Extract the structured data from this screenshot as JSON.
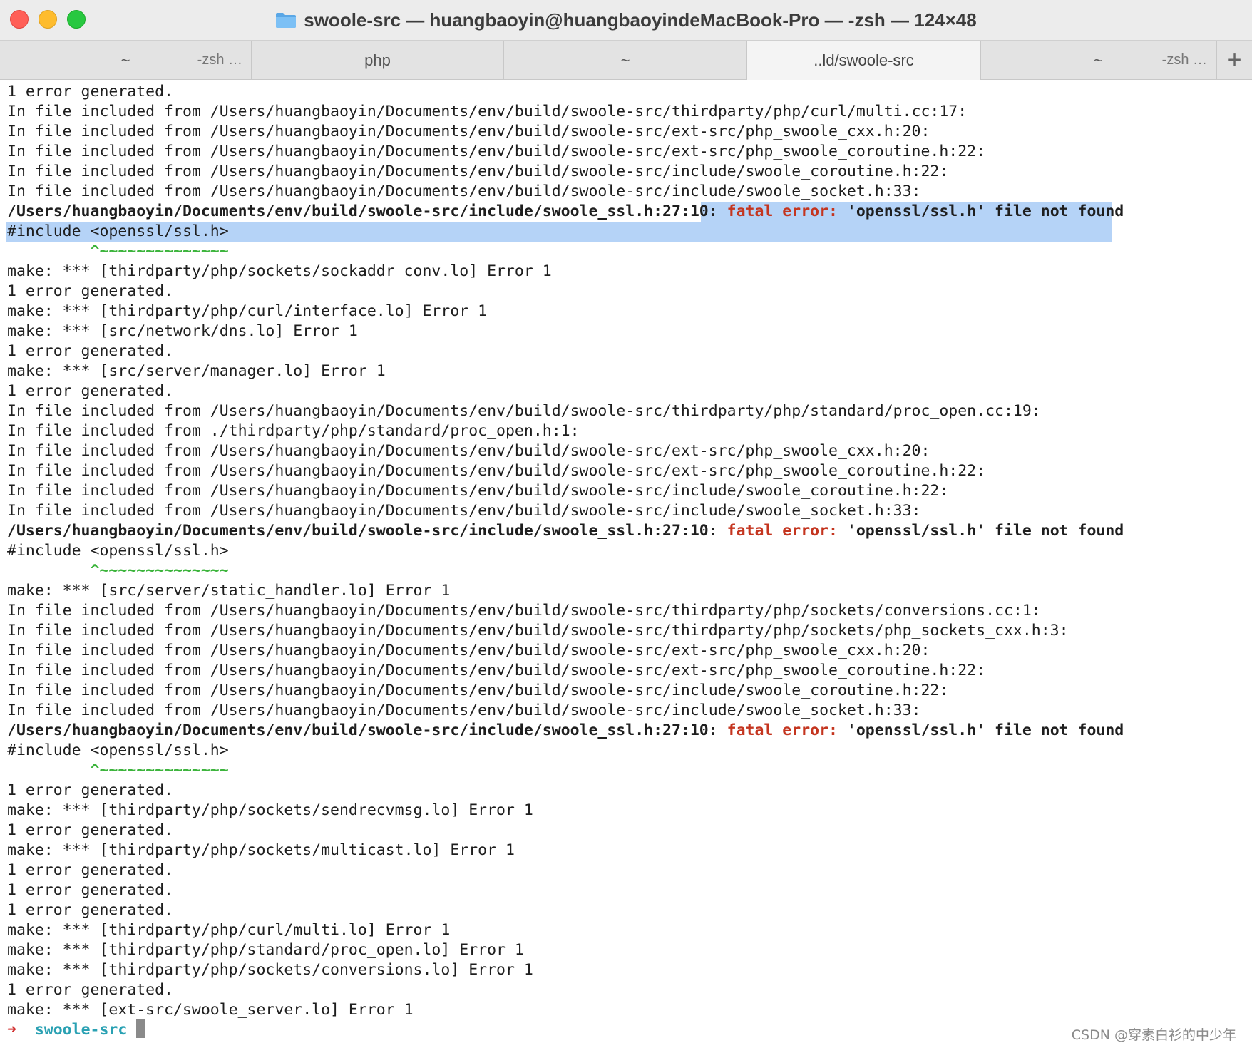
{
  "window": {
    "title": "swoole-src — huangbaoyin@huangbaoyindeMacBook-Pro — -zsh — 124×48"
  },
  "tabs": [
    {
      "label": "~",
      "process": "-zsh …",
      "active": false
    },
    {
      "label": "php",
      "process": "",
      "active": false
    },
    {
      "label": "~",
      "process": "",
      "active": false
    },
    {
      "label": "..ld/swoole-src",
      "process": "",
      "active": true
    },
    {
      "label": "~",
      "process": "-zsh …",
      "active": false
    }
  ],
  "new_tab_label": "+",
  "terminal": {
    "lines": [
      {
        "segments": [
          {
            "text": "1 error generated.",
            "style": "normal"
          }
        ]
      },
      {
        "segments": [
          {
            "text": "In file included from /Users/huangbaoyin/Documents/env/build/swoole-src/thirdparty/php/curl/multi.cc:17:",
            "style": "normal"
          }
        ]
      },
      {
        "segments": [
          {
            "text": "In file included from /Users/huangbaoyin/Documents/env/build/swoole-src/ext-src/php_swoole_cxx.h:20:",
            "style": "normal"
          }
        ]
      },
      {
        "segments": [
          {
            "text": "In file included from /Users/huangbaoyin/Documents/env/build/swoole-src/ext-src/php_swoole_coroutine.h:22:",
            "style": "normal"
          }
        ]
      },
      {
        "segments": [
          {
            "text": "In file included from /Users/huangbaoyin/Documents/env/build/swoole-src/include/swoole_coroutine.h:22:",
            "style": "normal"
          }
        ]
      },
      {
        "segments": [
          {
            "text": "In file included from /Users/huangbaoyin/Documents/env/build/swoole-src/include/swoole_socket.h:33:",
            "style": "normal"
          }
        ]
      },
      {
        "selected": "partial",
        "segments": [
          {
            "text": "/Users/huangbaoyin/Documents/env/build/swoole-src/include/swoole_ssl.h:27:10: ",
            "style": "bold"
          },
          {
            "text": "fatal error: ",
            "style": "fatal"
          },
          {
            "text": "'openssl/ssl.h' file not found",
            "style": "bold"
          }
        ]
      },
      {
        "selected": "full",
        "segments": [
          {
            "text": "#include <openssl/ssl.h>",
            "style": "normal"
          }
        ]
      },
      {
        "segments": [
          {
            "text": "         ^~~~~~~~~~~~~~~",
            "style": "caret"
          }
        ]
      },
      {
        "segments": [
          {
            "text": "make: *** [thirdparty/php/sockets/sockaddr_conv.lo] Error 1",
            "style": "normal"
          }
        ]
      },
      {
        "segments": [
          {
            "text": "1 error generated.",
            "style": "normal"
          }
        ]
      },
      {
        "segments": [
          {
            "text": "make: *** [thirdparty/php/curl/interface.lo] Error 1",
            "style": "normal"
          }
        ]
      },
      {
        "segments": [
          {
            "text": "make: *** [src/network/dns.lo] Error 1",
            "style": "normal"
          }
        ]
      },
      {
        "segments": [
          {
            "text": "1 error generated.",
            "style": "normal"
          }
        ]
      },
      {
        "segments": [
          {
            "text": "make: *** [src/server/manager.lo] Error 1",
            "style": "normal"
          }
        ]
      },
      {
        "segments": [
          {
            "text": "1 error generated.",
            "style": "normal"
          }
        ]
      },
      {
        "segments": [
          {
            "text": "In file included from /Users/huangbaoyin/Documents/env/build/swoole-src/thirdparty/php/standard/proc_open.cc:19:",
            "style": "normal"
          }
        ]
      },
      {
        "segments": [
          {
            "text": "In file included from ./thirdparty/php/standard/proc_open.h:1:",
            "style": "normal"
          }
        ]
      },
      {
        "segments": [
          {
            "text": "In file included from /Users/huangbaoyin/Documents/env/build/swoole-src/ext-src/php_swoole_cxx.h:20:",
            "style": "normal"
          }
        ]
      },
      {
        "segments": [
          {
            "text": "In file included from /Users/huangbaoyin/Documents/env/build/swoole-src/ext-src/php_swoole_coroutine.h:22:",
            "style": "normal"
          }
        ]
      },
      {
        "segments": [
          {
            "text": "In file included from /Users/huangbaoyin/Documents/env/build/swoole-src/include/swoole_coroutine.h:22:",
            "style": "normal"
          }
        ]
      },
      {
        "segments": [
          {
            "text": "In file included from /Users/huangbaoyin/Documents/env/build/swoole-src/include/swoole_socket.h:33:",
            "style": "normal"
          }
        ]
      },
      {
        "segments": [
          {
            "text": "/Users/huangbaoyin/Documents/env/build/swoole-src/include/swoole_ssl.h:27:10: ",
            "style": "bold"
          },
          {
            "text": "fatal error: ",
            "style": "fatal"
          },
          {
            "text": "'openssl/ssl.h' file not found",
            "style": "bold"
          }
        ]
      },
      {
        "segments": [
          {
            "text": "#include <openssl/ssl.h>",
            "style": "normal"
          }
        ]
      },
      {
        "segments": [
          {
            "text": "         ^~~~~~~~~~~~~~~",
            "style": "caret"
          }
        ]
      },
      {
        "segments": [
          {
            "text": "make: *** [src/server/static_handler.lo] Error 1",
            "style": "normal"
          }
        ]
      },
      {
        "segments": [
          {
            "text": "In file included from /Users/huangbaoyin/Documents/env/build/swoole-src/thirdparty/php/sockets/conversions.cc:1:",
            "style": "normal"
          }
        ]
      },
      {
        "segments": [
          {
            "text": "In file included from /Users/huangbaoyin/Documents/env/build/swoole-src/thirdparty/php/sockets/php_sockets_cxx.h:3:",
            "style": "normal"
          }
        ]
      },
      {
        "segments": [
          {
            "text": "In file included from /Users/huangbaoyin/Documents/env/build/swoole-src/ext-src/php_swoole_cxx.h:20:",
            "style": "normal"
          }
        ]
      },
      {
        "segments": [
          {
            "text": "In file included from /Users/huangbaoyin/Documents/env/build/swoole-src/ext-src/php_swoole_coroutine.h:22:",
            "style": "normal"
          }
        ]
      },
      {
        "segments": [
          {
            "text": "In file included from /Users/huangbaoyin/Documents/env/build/swoole-src/include/swoole_coroutine.h:22:",
            "style": "normal"
          }
        ]
      },
      {
        "segments": [
          {
            "text": "In file included from /Users/huangbaoyin/Documents/env/build/swoole-src/include/swoole_socket.h:33:",
            "style": "normal"
          }
        ]
      },
      {
        "segments": [
          {
            "text": "/Users/huangbaoyin/Documents/env/build/swoole-src/include/swoole_ssl.h:27:10: ",
            "style": "bold"
          },
          {
            "text": "fatal error: ",
            "style": "fatal"
          },
          {
            "text": "'openssl/ssl.h' file not found",
            "style": "bold"
          }
        ]
      },
      {
        "segments": [
          {
            "text": "#include <openssl/ssl.h>",
            "style": "normal"
          }
        ]
      },
      {
        "segments": [
          {
            "text": "         ^~~~~~~~~~~~~~~",
            "style": "caret"
          }
        ]
      },
      {
        "segments": [
          {
            "text": "1 error generated.",
            "style": "normal"
          }
        ]
      },
      {
        "segments": [
          {
            "text": "make: *** [thirdparty/php/sockets/sendrecvmsg.lo] Error 1",
            "style": "normal"
          }
        ]
      },
      {
        "segments": [
          {
            "text": "1 error generated.",
            "style": "normal"
          }
        ]
      },
      {
        "segments": [
          {
            "text": "make: *** [thirdparty/php/sockets/multicast.lo] Error 1",
            "style": "normal"
          }
        ]
      },
      {
        "segments": [
          {
            "text": "1 error generated.",
            "style": "normal"
          }
        ]
      },
      {
        "segments": [
          {
            "text": "1 error generated.",
            "style": "normal"
          }
        ]
      },
      {
        "segments": [
          {
            "text": "1 error generated.",
            "style": "normal"
          }
        ]
      },
      {
        "segments": [
          {
            "text": "make: *** [thirdparty/php/curl/multi.lo] Error 1",
            "style": "normal"
          }
        ]
      },
      {
        "segments": [
          {
            "text": "make: *** [thirdparty/php/standard/proc_open.lo] Error 1",
            "style": "normal"
          }
        ]
      },
      {
        "segments": [
          {
            "text": "make: *** [thirdparty/php/sockets/conversions.lo] Error 1",
            "style": "normal"
          }
        ]
      },
      {
        "segments": [
          {
            "text": "1 error generated.",
            "style": "normal"
          }
        ]
      },
      {
        "segments": [
          {
            "text": "make: *** [ext-src/swoole_server.lo] Error 1",
            "style": "normal"
          }
        ]
      }
    ],
    "prompt": {
      "arrow": "➜",
      "directory": "swoole-src"
    }
  },
  "watermark": "CSDN @穿素白衫的中少年",
  "colors": {
    "fatal": "#c4351f",
    "caret": "#3cb43c",
    "prompt_arrow": "#d12e2e",
    "prompt_dir": "#2aa1b3",
    "selection": "#b5d3f7"
  }
}
